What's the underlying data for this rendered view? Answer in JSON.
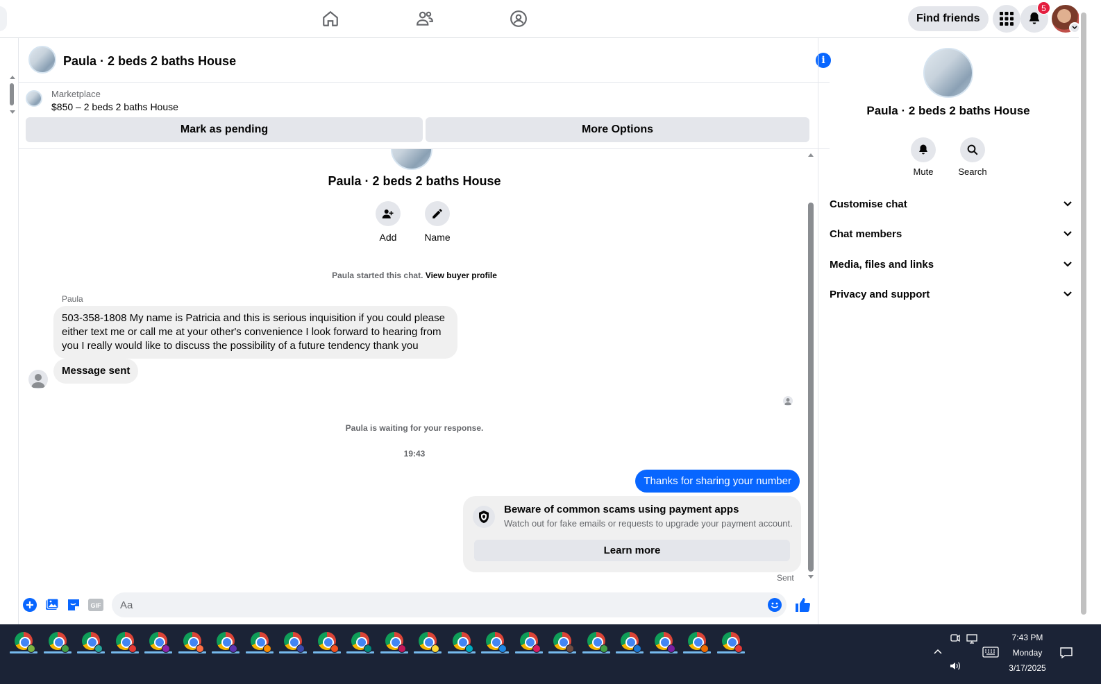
{
  "topnav": {
    "find_friends_label": "Find friends",
    "notification_count": "5"
  },
  "chat": {
    "title": "Paula · 2 beds 2 baths House",
    "marketplace": {
      "label": "Marketplace",
      "listing": "$850 – 2 beds 2 baths House",
      "mark_pending_label": "Mark as pending",
      "more_options_label": "More Options"
    },
    "intro": {
      "name": "Paula · 2 beds 2 baths House",
      "add_label": "Add",
      "name_label": "Name"
    },
    "started_text": "Paula started this chat.",
    "view_buyer_profile": "View buyer profile",
    "sender_name": "Paula",
    "incoming_message": "503-358-1808 My name is Patricia and this is serious inquisition if you could please either text me or call me at your other's convenience I look forward to hearing from you I really would like to discuss the possibility of a future tendency thank you",
    "message_sent_text": "Message sent",
    "waiting_text": "Paula is waiting for your response.",
    "timestamp": "19:43",
    "outgoing_message": "Thanks for sharing your number",
    "scam_card": {
      "title": "Beware of common scams using payment apps",
      "subtitle": "Watch out for fake emails or requests to upgrade your payment account.",
      "learn_more_label": "Learn more"
    },
    "sent_label": "Sent",
    "composer_placeholder": "Aa"
  },
  "right_panel": {
    "name": "Paula · 2 beds 2 baths House",
    "mute_label": "Mute",
    "search_label": "Search",
    "sections": [
      "Customise chat",
      "Chat members",
      "Media, files and links",
      "Privacy and support"
    ]
  },
  "taskbar": {
    "time": "7:43 PM",
    "day": "Monday",
    "date": "3/17/2025",
    "app_count": 22
  },
  "colors": {
    "accent": "#0866ff",
    "badge": "#e41e3f",
    "taskbar": "#1b2336"
  }
}
